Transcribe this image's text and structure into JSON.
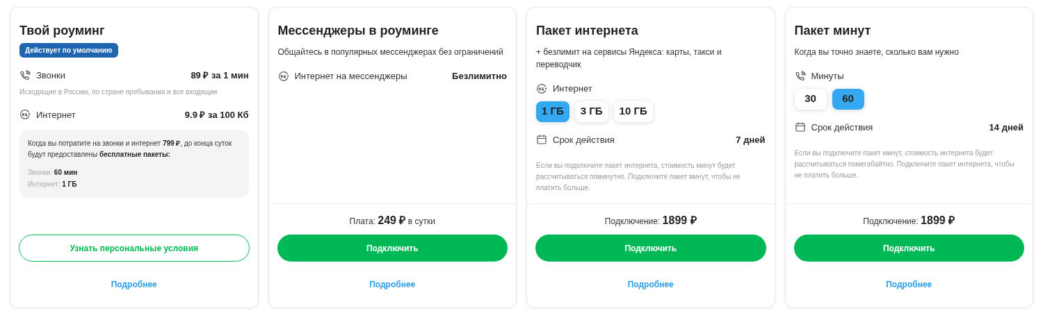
{
  "cards": [
    {
      "title": "Твой роуминг",
      "badge": "Действует по умолчанию",
      "blocks": [
        {
          "kind": "calls",
          "label": "Звонки",
          "value": "89 ₽ за 1 мин",
          "note": "Исходящие в Россию, по стране пребывания и все входящие"
        },
        {
          "kind": "internet",
          "label": "Интернет",
          "value": "9.9 ₽ за 100 Кб"
        },
        {
          "kind": "info",
          "text": "Когда вы потратите на звонки и интернет **799 ₽**, до конца суток будут предоставлены **бесплатные пакеты:**",
          "lines": [
            "Звонки: **60 мин**",
            "Интернет: **1 ГБ**"
          ]
        }
      ],
      "footer": {
        "button": {
          "label": "Узнать персональные условия",
          "kind": "outline"
        },
        "link": "Подробнее"
      }
    },
    {
      "title": "Мессенджеры в роуминге",
      "subtitle": "Общайтесь в популярных мессенджерах без ограничений",
      "blocks": [
        {
          "kind": "internet",
          "label": "Интернет на мессенджеры",
          "value": "Безлимитно"
        }
      ],
      "footer": {
        "price": "Плата: **249 ₽** в сутки",
        "button": {
          "label": "Подключить",
          "kind": "primary"
        },
        "link": "Подробнее"
      }
    },
    {
      "title": "Пакет интернета",
      "subtitle": "+ безлимит на сервисы Яндекса: карты, такси и переводчик",
      "blocks": [
        {
          "kind": "internet",
          "label": "Интернет",
          "options": [
            {
              "label": "1 ГБ",
              "selected": true
            },
            {
              "label": "3 ГБ",
              "selected": false
            },
            {
              "label": "10 ГБ",
              "selected": false
            }
          ]
        },
        {
          "kind": "period",
          "label": "Срок действия",
          "value": "7 дней"
        },
        {
          "kind": "note",
          "text": "Если вы подключите пакет интернета, стоимость минут будет рассчитываться поминутно. Подключите пакет минут, чтобы не платить больше."
        }
      ],
      "footer": {
        "price": "Подключение: **1899 ₽**",
        "button": {
          "label": "Подключить",
          "kind": "primary"
        },
        "link": "Подробнее"
      }
    },
    {
      "title": "Пакет минут",
      "subtitle": "Когда вы точно знаете, сколько вам нужно",
      "blocks": [
        {
          "kind": "calls",
          "label": "Минуты",
          "options": [
            {
              "label": "30",
              "selected": false
            },
            {
              "label": "60",
              "selected": true
            }
          ]
        },
        {
          "kind": "period",
          "label": "Срок действия",
          "value": "14 дней"
        },
        {
          "kind": "note",
          "text": "Если вы подключите пакет минут, стоимость интернета будет рассчитываться помегабайтно. Подключите пакет интернета, чтобы не платить больше."
        }
      ],
      "footer": {
        "price": "Подключение: **1899 ₽**",
        "button": {
          "label": "Подключить",
          "kind": "primary"
        },
        "link": "Подробнее"
      }
    }
  ]
}
